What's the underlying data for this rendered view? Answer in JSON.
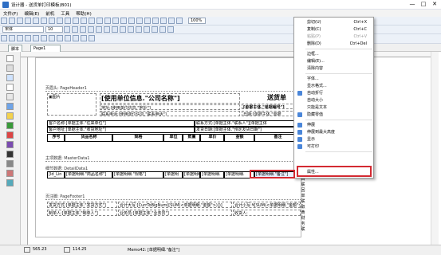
{
  "window": {
    "title": "设计器 - 送货单打印模板(B01)",
    "minimize": "—",
    "maximize": "□",
    "close": "✕"
  },
  "menu": [
    "文件(F)",
    "编辑(E)",
    "前机",
    "工具",
    "帮助(H)"
  ],
  "toolbar": {
    "font_name": "宋体",
    "font_size": "10",
    "zoom": "100%"
  },
  "tabs": {
    "t1": "脚本",
    "t2": "Page1"
  },
  "band": {
    "page_header": "页眉头: PageHeader1",
    "master": "主项数据: MasterData1",
    "detail": "细节数据: DetailData1",
    "page_footer": "页注脚: PageFooter1"
  },
  "header": {
    "image": "图片",
    "title": "[使用单位信息.\"公司名称\"]",
    "doc_title": "送货单",
    "address": "地址:[使用单位信息.\"地址\"]",
    "contact": "联系电话:[使用单位信息.\"联系电话\"]",
    "head_no": "[单据主体.\"单据编号\"]",
    "date": "日期:[单据主体.\"单据",
    "customer": "客户名称:[单据主体.\"往来单位\"]",
    "cust_addr": "客户地址:[单据主体.\"收货地址\"]",
    "cust_contact": "联系方式:[单据主体.\"联系人\"][单据主体",
    "ship_date": "发货日期:[单据主体.\"预定发货日期\"]",
    "dash": "——"
  },
  "columns": [
    "序号",
    "货品名称",
    "规格",
    "单位",
    "数量",
    "单价",
    "金额",
    "备注"
  ],
  "detail_row": [
    "[Id_Lin",
    "[单据明细.\"商品名称\"]",
    "[单据明细.\"规格\"]",
    "[单据明",
    "[单据明细.",
    "[单据明细.",
    "[单据明细.",
    "[单据明细.\"备注\"]"
  ],
  "footer": {
    "ship_method": "发货方式:[单据主体.\"发货方式\"]",
    "amount_upper": "合计大写:[CurrToBigNum([SUM(<单据明细.\"金额\">)])]",
    "amount_small": "合计小写:¥[SUM(<单据明细.\"金额\">)]",
    "maker": "制单人:[单据主体.\"制单人\"]",
    "sales": "业务员:[单据主体.\"业务员\"]",
    "receiver": "收货人:"
  },
  "side_labels": [
    "白",
    "联",
    "回",
    "单",
    "联",
    "取",
    "黄",
    "财",
    "务",
    "联"
  ],
  "statusbar": {
    "pos1": "565.23",
    "pos2": "114.25",
    "info": "Memo42: [单据明细.\"备注\"]"
  },
  "context_menu": [
    {
      "label": "剪切(U)",
      "shortcut": "Ctrl+X",
      "checked": false,
      "disabled": false
    },
    {
      "label": "复制(C)",
      "shortcut": "Ctrl+C",
      "checked": false,
      "disabled": false
    },
    {
      "label": "粘贴(P)",
      "shortcut": "Ctrl+V",
      "checked": false,
      "disabled": true
    },
    {
      "label": "删除(D)",
      "shortcut": "Ctrl+Del",
      "checked": false,
      "disabled": false
    },
    {
      "label": "边框...",
      "shortcut": "",
      "checked": false,
      "disabled": false
    },
    {
      "label": "编辑(E)...",
      "shortcut": "",
      "checked": false,
      "disabled": false
    },
    {
      "label": "清除内容",
      "shortcut": "",
      "checked": false,
      "disabled": false
    },
    {
      "label": "字体...",
      "shortcut": "",
      "checked": false,
      "disabled": false
    },
    {
      "label": "显示格式...",
      "shortcut": "",
      "checked": false,
      "disabled": false
    },
    {
      "label": "自动折行",
      "shortcut": "",
      "checked": true,
      "disabled": false
    },
    {
      "label": "自动大小",
      "shortcut": "",
      "checked": false,
      "disabled": false
    },
    {
      "label": "只能是文本",
      "shortcut": "",
      "checked": false,
      "disabled": false
    },
    {
      "label": "隐藏零值",
      "shortcut": "",
      "checked": true,
      "disabled": false
    },
    {
      "label": "伸展",
      "shortcut": "",
      "checked": true,
      "disabled": false
    },
    {
      "label": "伸展到最大高度",
      "shortcut": "",
      "checked": true,
      "disabled": false
    },
    {
      "label": "显示",
      "shortcut": "",
      "checked": true,
      "disabled": false
    },
    {
      "label": "可打印",
      "shortcut": "",
      "checked": true,
      "disabled": false
    },
    {
      "label": "属性...",
      "shortcut": "",
      "checked": false,
      "disabled": false
    }
  ]
}
